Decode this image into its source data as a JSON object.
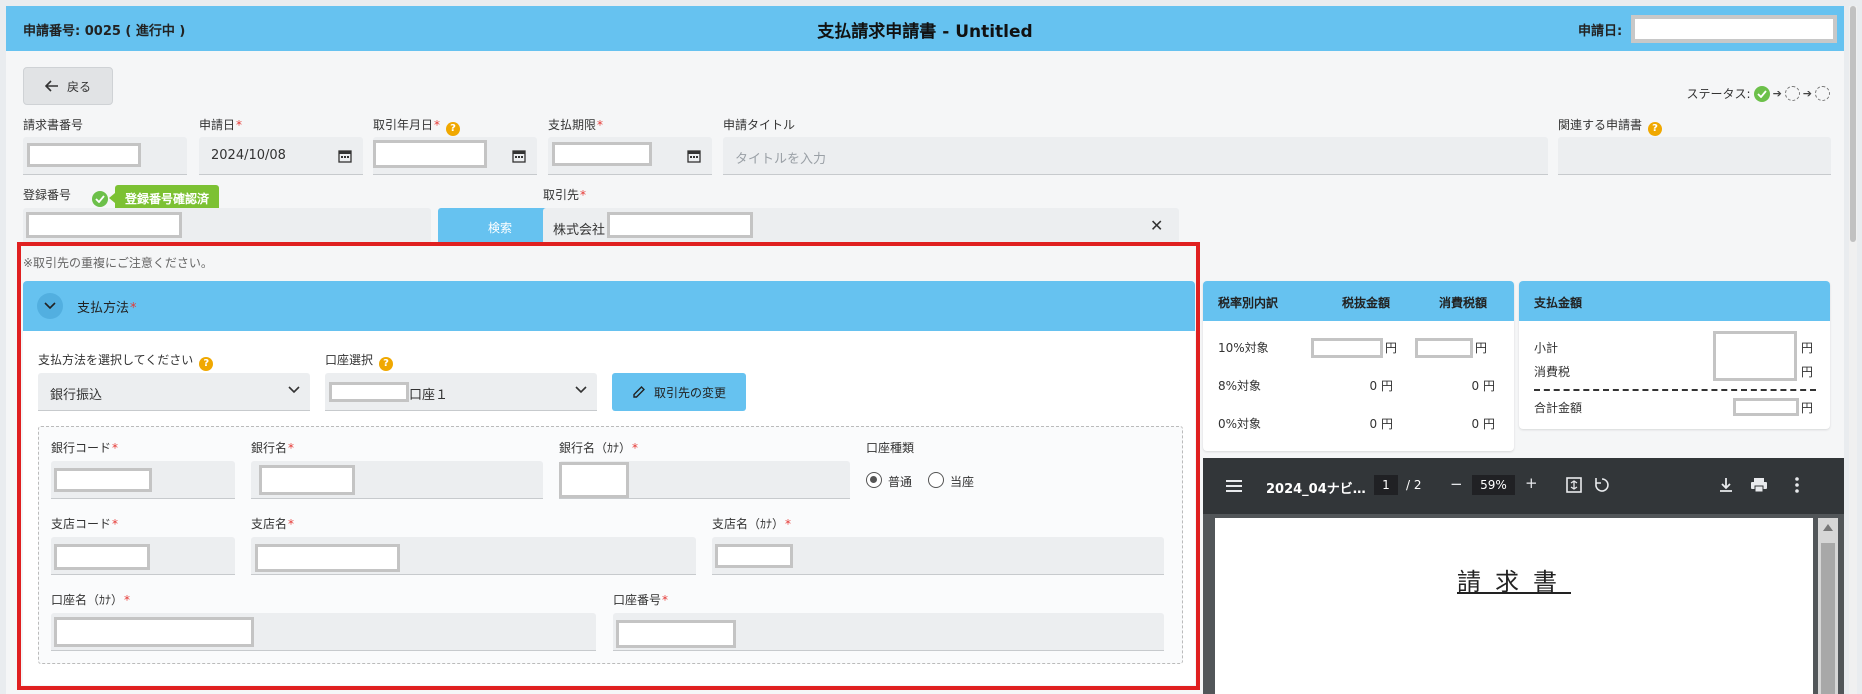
{
  "header": {
    "request_no": "申請番号: 0025 ( 進行中 )",
    "title": "支払請求申請書 - Untitled",
    "date_label": "申請日:"
  },
  "toolbar": {
    "back_label": "戻る",
    "status_label": "ステータス:"
  },
  "form": {
    "invoice_no_label": "請求書番号",
    "apply_date_label": "申請日",
    "apply_date_value": "2024/10/08",
    "trade_date_label": "取引年月日",
    "due_label": "支払期限",
    "title_label": "申請タイトル",
    "title_placeholder": "タイトルを入力",
    "related_label": "関連する申請書",
    "reg_no_label": "登録番号",
    "reg_badge": "登録番号確認済",
    "search_label": "検索",
    "vendor_label": "取引先",
    "vendor_value": "株式会社",
    "note": "※取引先の重複にご注意ください。"
  },
  "payment": {
    "section_title": "支払方法",
    "method_label": "支払方法を選択してください",
    "method_value": "銀行振込",
    "account_label": "口座選択",
    "account_value": "口座１",
    "change_label": "取引先の変更",
    "bank_code": "銀行コード",
    "bank_name": "銀行名",
    "bank_name_kana": "銀行名（ｶﾅ）",
    "account_type": "口座種類",
    "type_normal": "普通",
    "type_current": "当座",
    "branch_code": "支店コード",
    "branch_name": "支店名",
    "branch_name_kana": "支店名（ｶﾅ）",
    "holder_kana": "口座名（ｶﾅ）",
    "account_no": "口座番号"
  },
  "tax": {
    "headers": [
      "税率別内訳",
      "税抜金額",
      "消費税額"
    ],
    "rows": [
      {
        "label": "10%対象",
        "net": "",
        "tax": ""
      },
      {
        "label": "8%対象",
        "net": "0 円",
        "tax": "0 円"
      },
      {
        "label": "0%対象",
        "net": "0 円",
        "tax": "0 円"
      }
    ],
    "yen": "円"
  },
  "amount": {
    "header": "支払金額",
    "subtotal": "小計",
    "tax": "消費税",
    "total": "合計金額",
    "yen": "円"
  },
  "pdf": {
    "file_name": "2024_04ナビ…",
    "page": "1",
    "page_total": "/  2",
    "zoom": "59%",
    "doc_title": "請求書"
  }
}
